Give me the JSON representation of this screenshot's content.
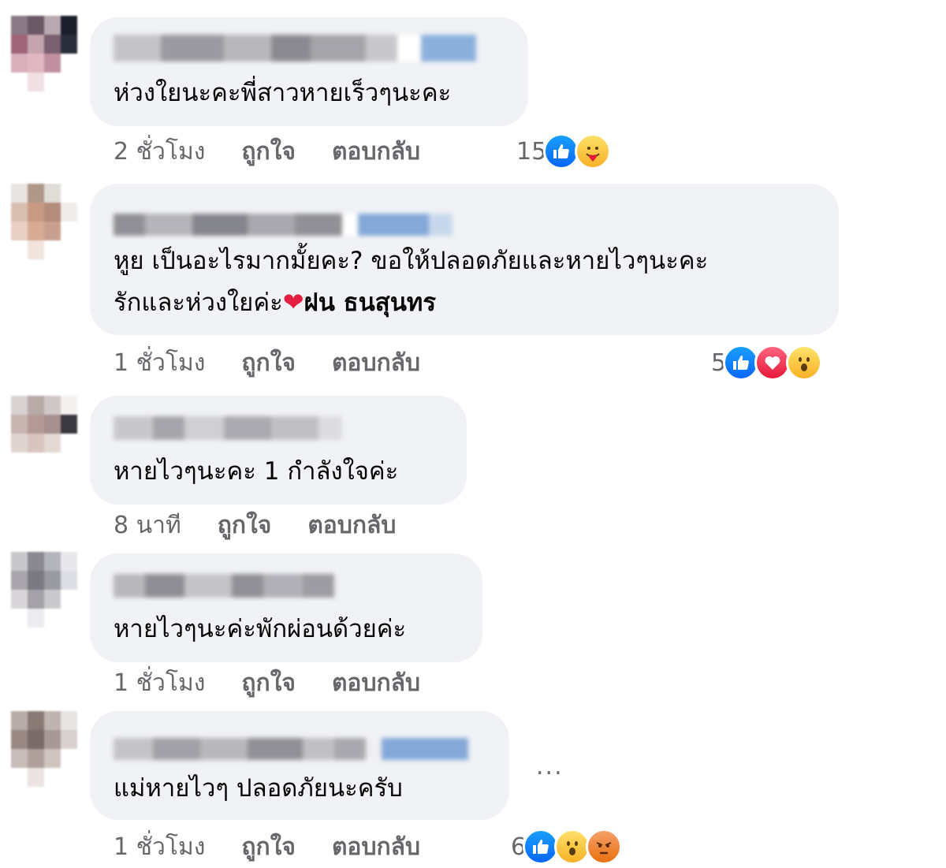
{
  "comments": [
    {
      "text": "ห่วงใยนะคะพี่สาวหายเร็วๆนะคะ",
      "time": "2 ชั่วโมง",
      "like_label": "ถูกใจ",
      "reply_label": "ตอบกลับ",
      "reaction_count": "15",
      "reactions": [
        "like-icon",
        "care-icon"
      ]
    },
    {
      "text_line1": "หูย เป็นอะไรมากมั้ยคะ? ขอให้ปลอดภัยและหายไวๆนะคะ",
      "text_line2": "รักและห่วงใยค่ะ",
      "tag": "ฝน ธนสุนทร",
      "time": "1 ชั่วโมง",
      "like_label": "ถูกใจ",
      "reply_label": "ตอบกลับ",
      "reaction_count": "5",
      "reactions": [
        "like-icon",
        "love-icon",
        "wow-icon"
      ]
    },
    {
      "text": "หายไวๆนะคะ 1 กำลังใจค่ะ",
      "time": "8 นาที",
      "like_label": "ถูกใจ",
      "reply_label": "ตอบกลับ"
    },
    {
      "text": "หายไวๆนะค่ะพักผ่อนด้วยค่ะ",
      "time": "1 ชั่วโมง",
      "like_label": "ถูกใจ",
      "reply_label": "ตอบกลับ"
    },
    {
      "text": "แม่หายไวๆ ปลอดภัยนะครับ",
      "time": "1 ชั่วโมง",
      "like_label": "ถูกใจ",
      "reply_label": "ตอบกลับ",
      "reaction_count": "6",
      "reactions": [
        "like-icon",
        "wow-icon",
        "angry-icon"
      ],
      "more_label": "..."
    }
  ],
  "colors": {
    "bubble": "#f0f2f5",
    "meta_text": "#65676b",
    "like": "#0866ff",
    "love": "#e61739",
    "wow": "#f7b125",
    "angry": "#e9710f"
  }
}
